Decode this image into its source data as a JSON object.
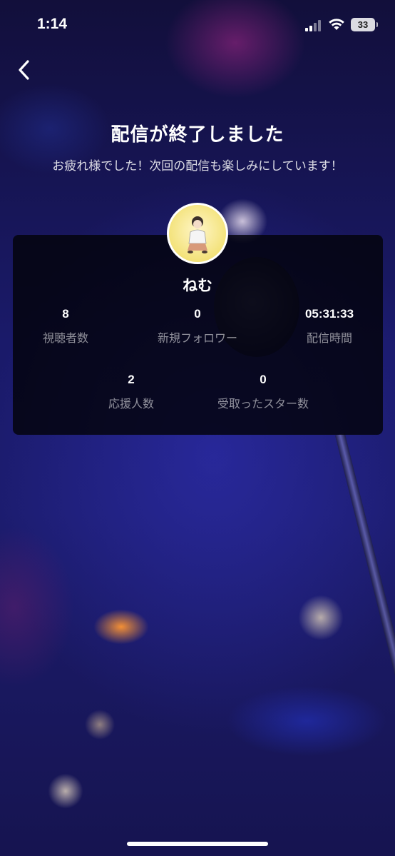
{
  "status_bar": {
    "time": "1:14",
    "battery_level": "33"
  },
  "header": {
    "title": "配信が終了しました",
    "subtitle": "お疲れ様でした！次回の配信も楽しみにしています！"
  },
  "profile": {
    "username": "ねむ"
  },
  "stats": {
    "viewers": {
      "value": "8",
      "label": "視聴者数"
    },
    "new_followers": {
      "value": "0",
      "label": "新規フォロワー"
    },
    "stream_time": {
      "value": "05:31:33",
      "label": "配信時間"
    },
    "supporters": {
      "value": "2",
      "label": "応援人数"
    },
    "stars_received": {
      "value": "0",
      "label": "受取ったスター数"
    }
  },
  "icons": {
    "back": "chevron-left-icon",
    "signal": "cellular-signal-icon",
    "wifi": "wifi-icon",
    "battery": "battery-icon"
  }
}
